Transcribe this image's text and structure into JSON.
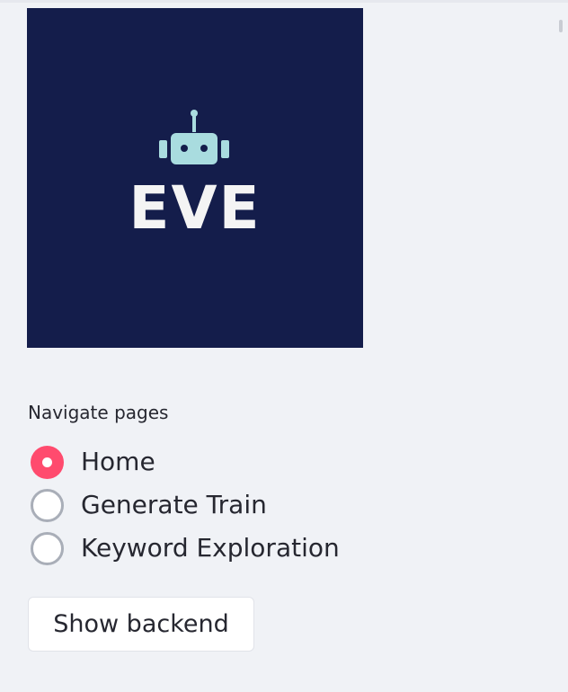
{
  "logo": {
    "text": "EVE",
    "background_color": "#141d4b",
    "text_color": "#f4f4f4",
    "icon": "robot-icon",
    "icon_color": "#a9dcdf"
  },
  "navigation": {
    "label": "Navigate pages",
    "options": [
      {
        "label": "Home",
        "selected": true
      },
      {
        "label": "Generate Train",
        "selected": false
      },
      {
        "label": "Keyword Exploration",
        "selected": false
      }
    ]
  },
  "backend_button": {
    "label": "Show backend"
  },
  "colors": {
    "accent": "#ff4b6e",
    "background": "#f0f2f6",
    "text": "#262730"
  }
}
